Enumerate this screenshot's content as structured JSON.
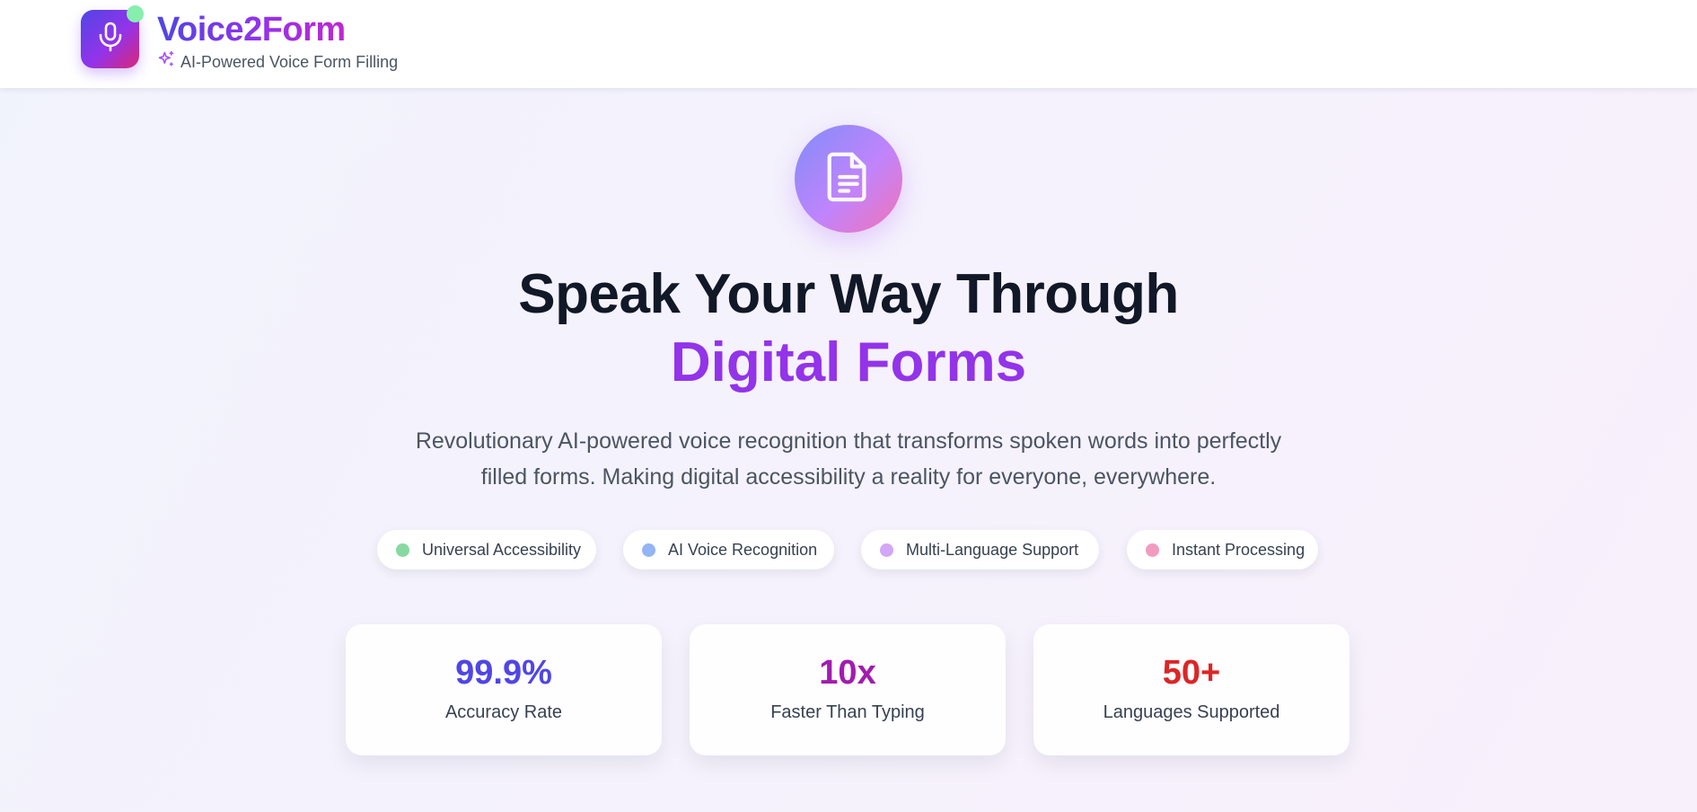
{
  "header": {
    "brand_title": "Voice2Form",
    "brand_subtitle": "AI-Powered Voice Form Filling",
    "logo_icon": "microphone-icon",
    "subtitle_icon": "sparkles-icon"
  },
  "hero": {
    "icon": "document-icon",
    "title_line1": "Speak Your Way Through",
    "title_line2": "Digital Forms",
    "description": "Revolutionary AI-powered voice recognition that transforms spoken words into perfectly filled forms. Making digital accessibility a reality for everyone, everywhere."
  },
  "features": [
    {
      "label": "Universal Accessibility",
      "dot_color": "#86d9a0"
    },
    {
      "label": "AI Voice Recognition",
      "dot_color": "#93b4f5"
    },
    {
      "label": "Multi-Language Support",
      "dot_color": "#d3a6f7"
    },
    {
      "label": "Instant Processing",
      "dot_color": "#f19bc0"
    }
  ],
  "stats": [
    {
      "value": "99.9%",
      "label": "Accuracy Rate",
      "color": "#4f46e5"
    },
    {
      "value": "10x",
      "label": "Faster Than Typing",
      "color": "#a21caf"
    },
    {
      "value": "50+",
      "label": "Languages Supported",
      "color": "#dc2626"
    }
  ],
  "colors": {
    "brand_gradient_start": "#4f46e5",
    "brand_gradient_mid": "#9333ea",
    "brand_gradient_end": "#db2777",
    "accent_purple": "#9333ea",
    "status_dot_green": "#86efac"
  }
}
